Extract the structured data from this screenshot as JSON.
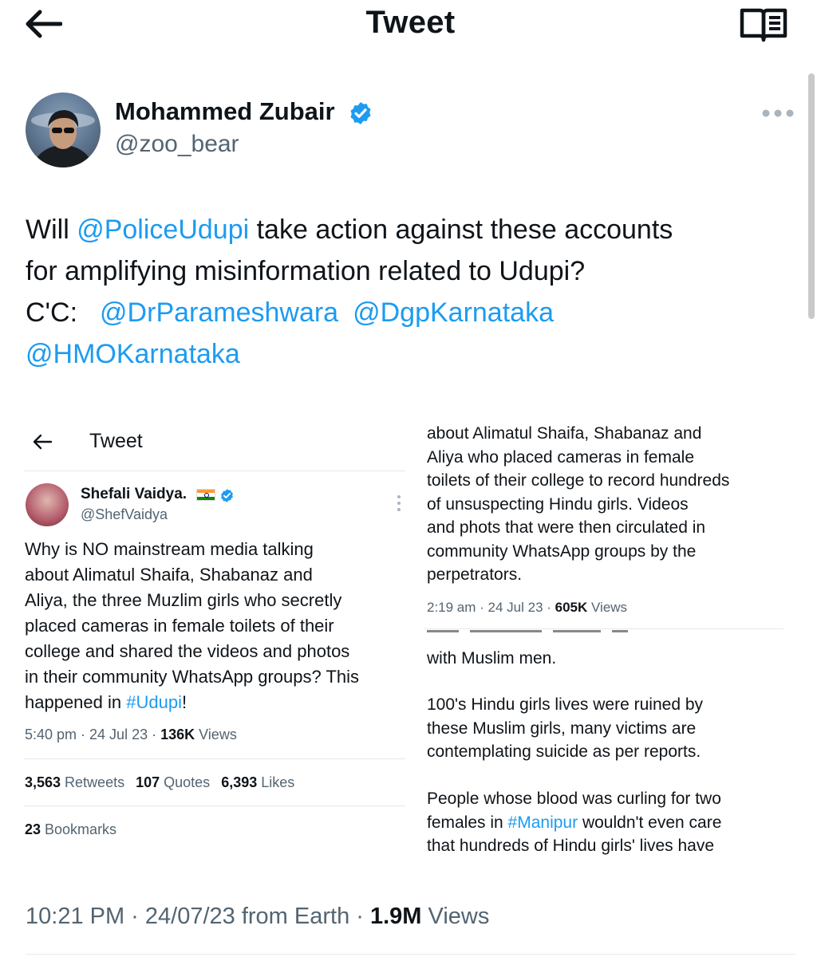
{
  "header": {
    "title": "Tweet",
    "back_icon": "arrow-left-icon",
    "reader_icon": "book-reader-icon"
  },
  "author": {
    "name": "Mohammed Zubair",
    "handle": "@zoo_bear",
    "verified": true
  },
  "tweet": {
    "line1": {
      "pre": "Will ",
      "mention": "@PoliceUdupi",
      "post": " take action against these accounts"
    },
    "line2": "for amplifying misinformation related to Udupi?",
    "line3": {
      "cc": "C'C:",
      "m1": "@DrParameshwara",
      "m2": "@DgpKarnataka"
    },
    "line4": "@HMOKarnataka"
  },
  "embedded": {
    "title": "Tweet",
    "author_name": "Shefali Vaidya.",
    "author_handle": "@ShefVaidya",
    "body_lines": [
      "Why is NO mainstream media talking",
      "about Alimatul Shaifa, Shabanaz and",
      "Aliya, the three Muzlim girls who secretly",
      "placed cameras in female toilets of their",
      "college and shared the videos and photos",
      "in their community WhatsApp groups? This"
    ],
    "body_last": {
      "pre": "happened in ",
      "tag": "#Udupi",
      "post": "!"
    },
    "meta": {
      "time_date": "5:40 pm · 24 Jul 23 · ",
      "views": "136K",
      "views_label": " Views"
    },
    "stats": {
      "retweets": "3,563",
      "retweets_label": " Retweets",
      "quotes": "107",
      "quotes_label": " Quotes",
      "likes": "6,393",
      "likes_label": " Likes"
    },
    "bookmarks": {
      "count": "23",
      "label": " Bookmarks"
    },
    "right_lines": [
      "about Alimatul Shaifa, Shabanaz and",
      "Aliya who placed cameras in female",
      "toilets of their college to record hundreds",
      "of unsuspecting Hindu girls. Videos",
      "and phots that were then circulated in",
      "community WhatsApp groups by the",
      "perpetrators."
    ],
    "right_meta": {
      "time_date": "2:19 am · 24 Jul 23 · ",
      "views": "605K",
      "views_label": " Views"
    },
    "right_p1": "with Muslim men.",
    "right_p2": [
      "100's Hindu girls lives were ruined by",
      "these Muslim girls, many victims are",
      "contemplating suicide as per reports."
    ],
    "right_p3": {
      "line1": "People whose blood was curling for two",
      "line2_pre": "females in ",
      "line2_tag": "#Manipur",
      "line2_post": " wouldn't even care",
      "line3": "that hundreds of Hindu girls' lives have"
    }
  },
  "footer": {
    "time_date": "10:21 PM · 24/07/23 from Earth · ",
    "views": "1.9M",
    "views_label": " Views"
  },
  "colors": {
    "link": "#1d9bf0",
    "secondary_text": "#536471",
    "primary_text": "#0f1419"
  }
}
